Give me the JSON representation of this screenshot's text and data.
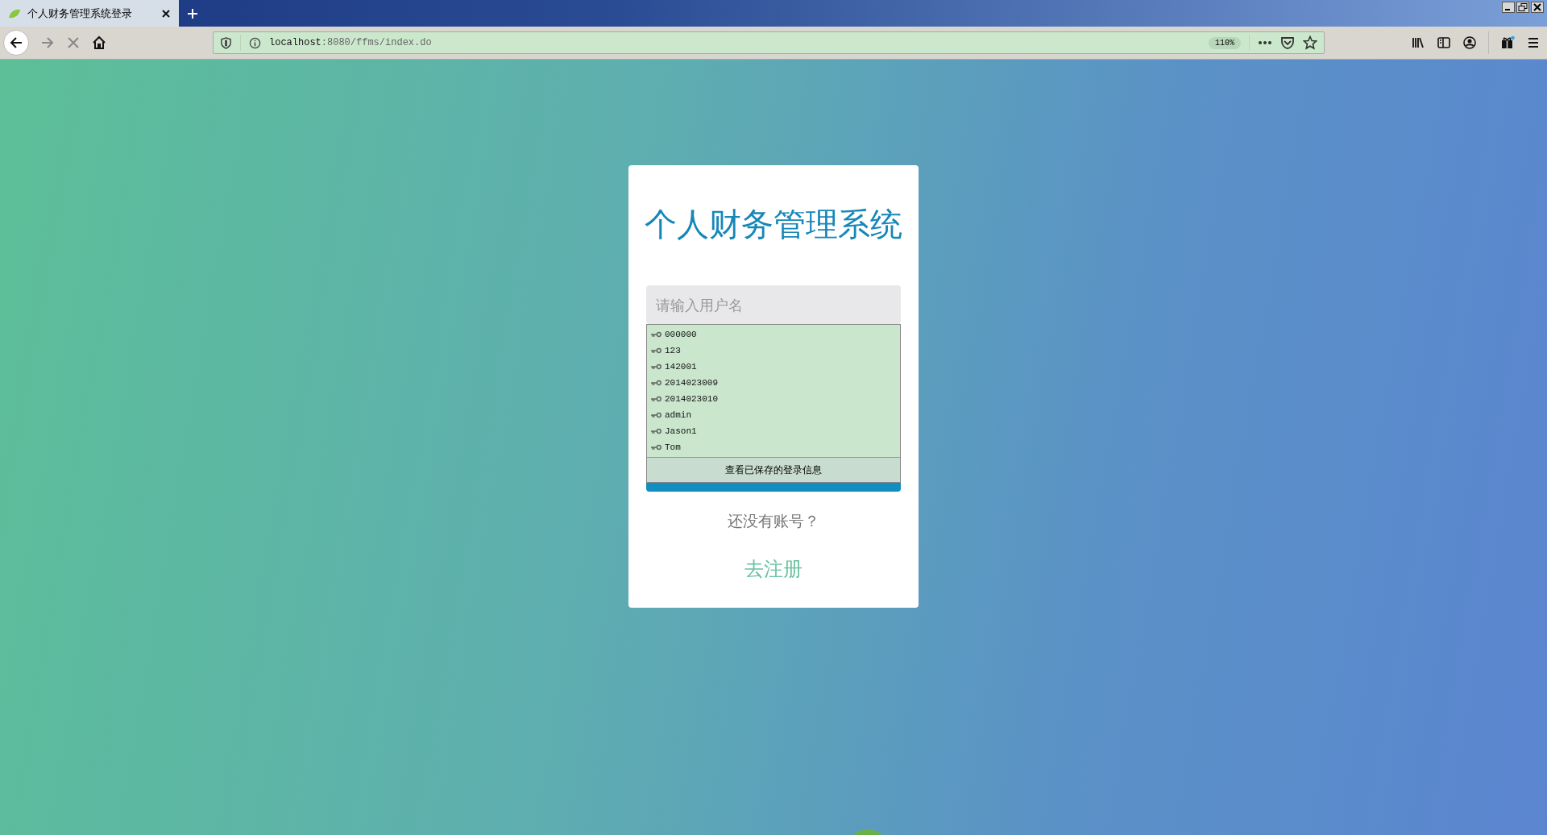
{
  "browser": {
    "tab": {
      "title": "个人财务管理系统登录"
    },
    "url": {
      "host": "localhost",
      "rest": ":8080/ffms/index.do"
    },
    "zoom": "110%"
  },
  "login": {
    "title": "个人财务管理系统",
    "username": {
      "placeholder": "请输入用户名"
    },
    "autocomplete": {
      "items": [
        "000000",
        "123",
        "142001",
        "2014023009",
        "2014023010",
        "admin",
        "Jason1",
        "Tom"
      ],
      "footer": "查看已保存的登录信息"
    },
    "no_account": "还没有账号？",
    "register_link": "去注册"
  }
}
